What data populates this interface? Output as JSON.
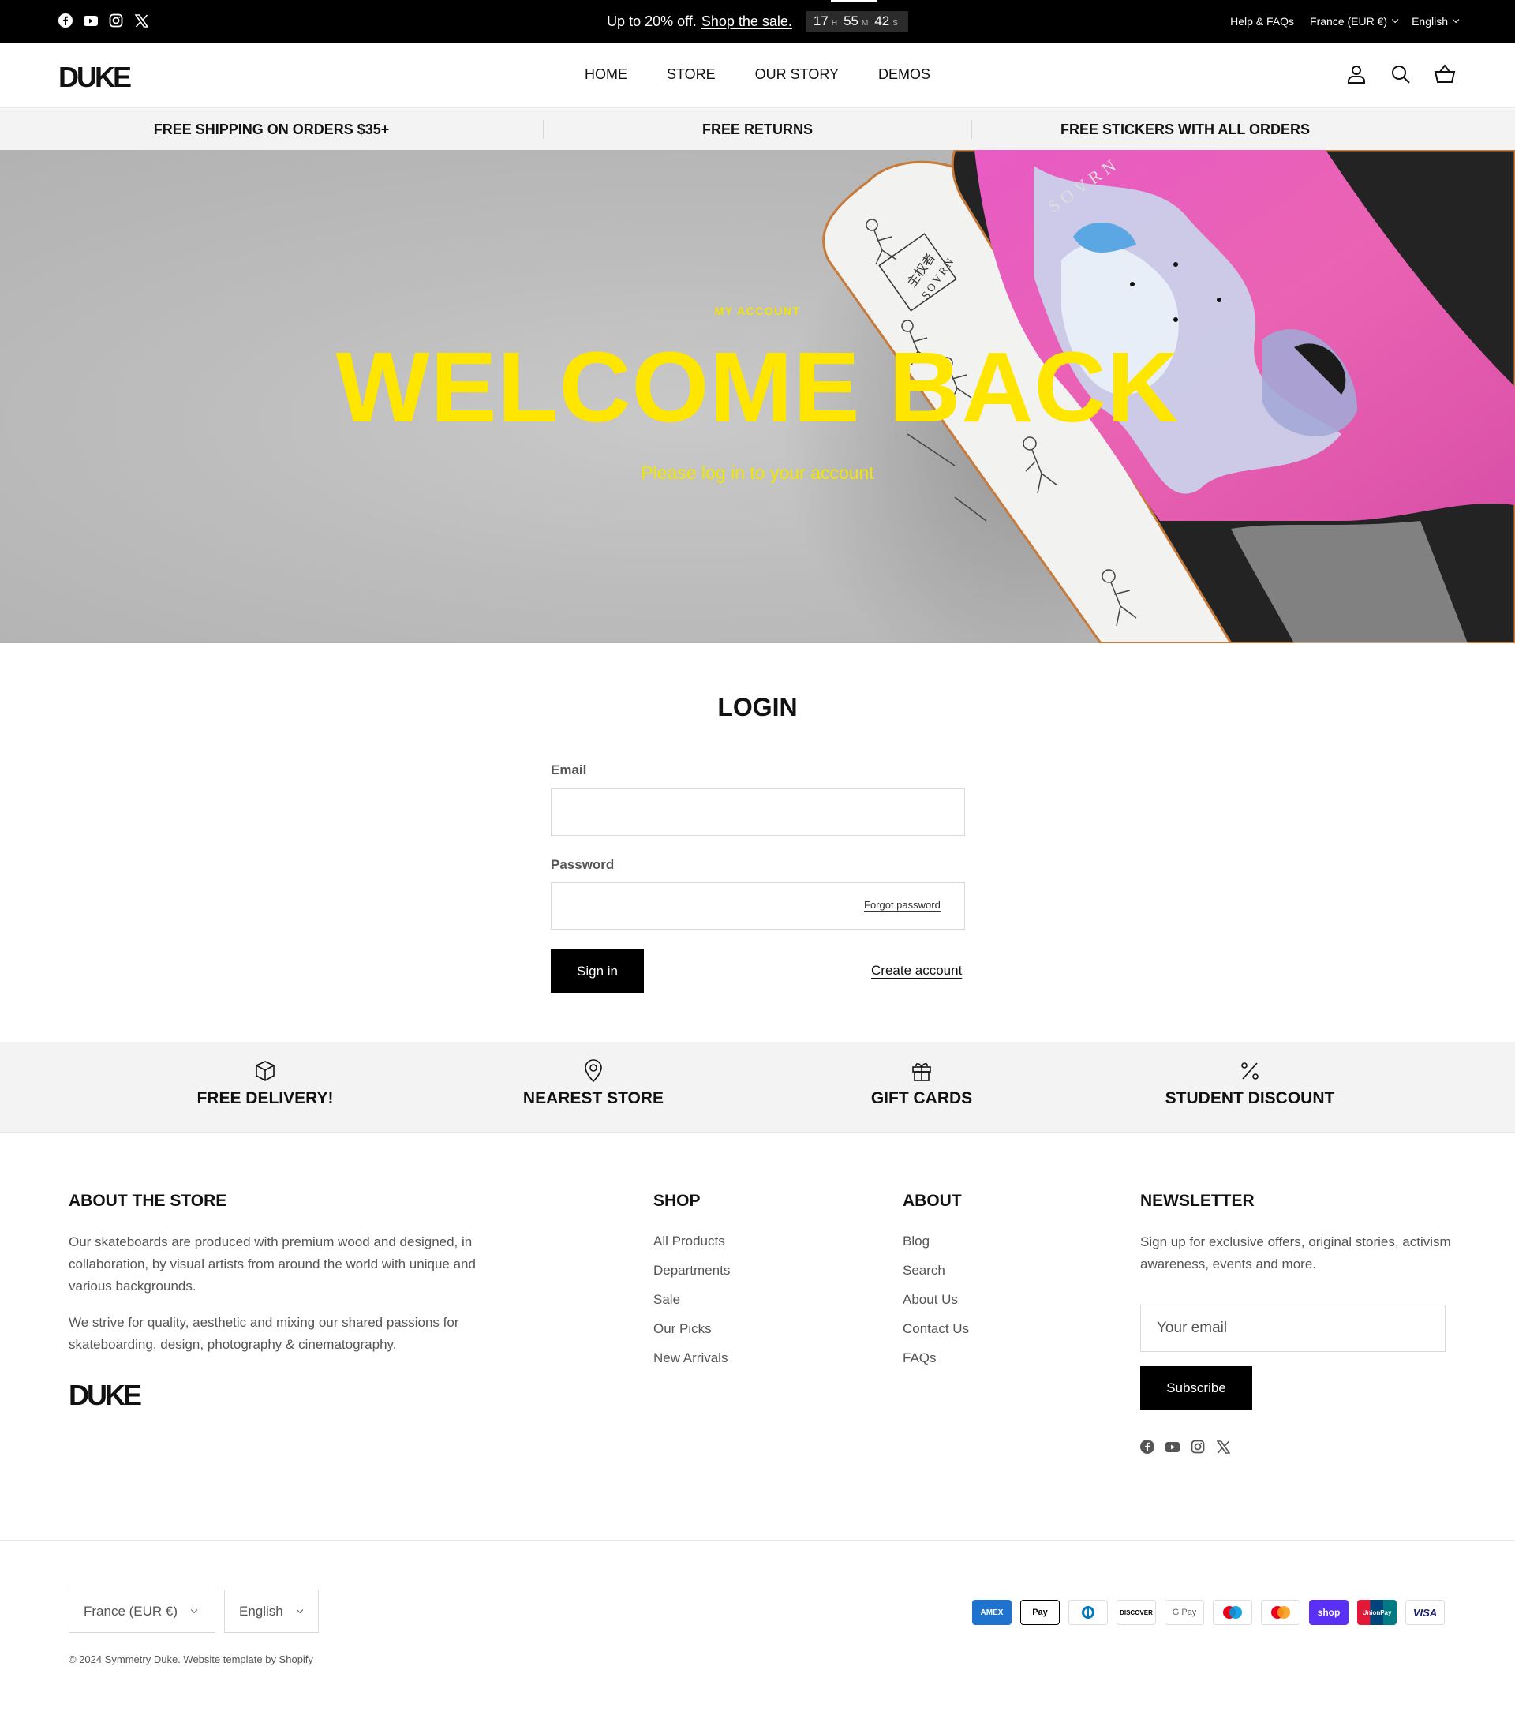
{
  "announcement": {
    "promo_text": "Up to 20% off.",
    "promo_link": "Shop the sale.",
    "timer_hours": "17",
    "timer_hours_unit": "H",
    "timer_minutes": "55",
    "timer_minutes_unit": "M",
    "timer_seconds": "42",
    "timer_seconds_unit": "S",
    "help_link": "Help & FAQs",
    "country": "France (EUR €)",
    "language": "English"
  },
  "header": {
    "logo": "DUKE",
    "nav": [
      "HOME",
      "STORE",
      "OUR STORY",
      "DEMOS"
    ]
  },
  "usp": [
    "FREE SHIPPING ON ORDERS $35+",
    "FREE RETURNS",
    "FREE STICKERS WITH ALL ORDERS"
  ],
  "hero": {
    "kicker": "MY ACCOUNT",
    "title": "WELCOME BACK",
    "subtitle": "Please log in to your account",
    "board_text_1": "SOVRN",
    "board_text_2": "SOVRN",
    "board_text_3": "主权者"
  },
  "login": {
    "title": "LOGIN",
    "email_label": "Email",
    "email_value": "",
    "password_label": "Password",
    "password_value": "",
    "forgot_label": "Forgot password",
    "signin_label": "Sign in",
    "create_label": "Create account"
  },
  "features": [
    "FREE DELIVERY!",
    "NEAREST STORE",
    "GIFT CARDS",
    "STUDENT DISCOUNT"
  ],
  "footer": {
    "about": {
      "heading": "ABOUT THE STORE",
      "para1": "Our skateboards are produced with premium wood and designed, in collaboration, by visual artists from around the world with unique and various backgrounds.",
      "para2": "We strive for quality, aesthetic and mixing our shared passions for skateboarding, design, photography & cinematography.",
      "logo": "DUKE"
    },
    "shop": {
      "heading": "SHOP",
      "links": [
        "All Products",
        "Departments",
        "Sale",
        "Our Picks",
        "New Arrivals"
      ]
    },
    "about_links": {
      "heading": "ABOUT",
      "links": [
        "Blog",
        "Search",
        "About Us",
        "Contact Us",
        "FAQs"
      ]
    },
    "newsletter": {
      "heading": "NEWSLETTER",
      "text": "Sign up for exclusive offers, original stories, activism awareness, events and more.",
      "placeholder": "Your email",
      "button": "Subscribe"
    },
    "country_select": "France (EUR €)",
    "language_select": "English",
    "copyright": "© 2024 Symmetry Duke. Website template by Shopify",
    "payments": [
      "AMEX",
      "Pay",
      "",
      "DISCOVER",
      "G Pay",
      "",
      "",
      "shop",
      "UnionPay",
      "VISA"
    ]
  },
  "colors": {
    "accent_yellow": "#ffe600",
    "black": "#000000",
    "strip_gray": "#f3f3f3"
  }
}
